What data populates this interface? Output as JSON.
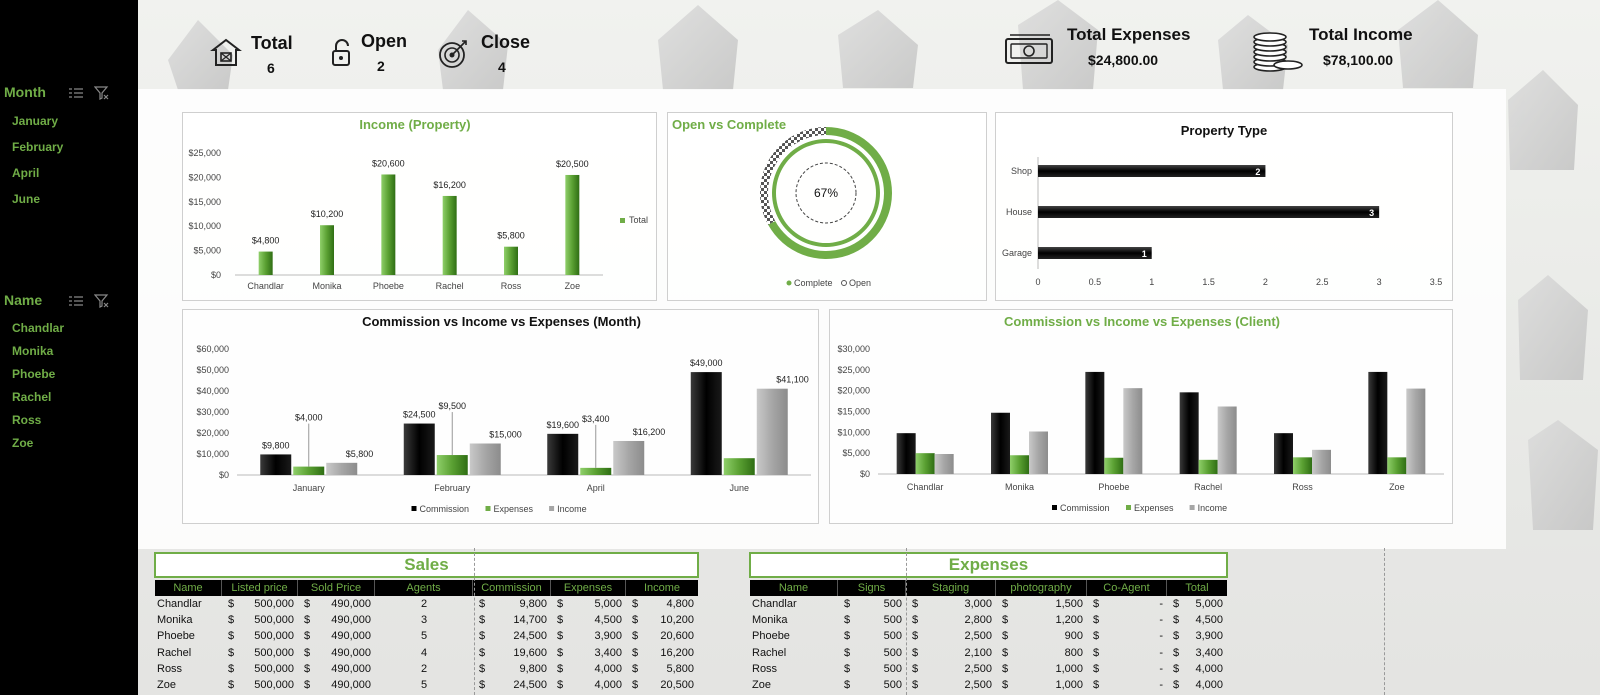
{
  "sidebar": {
    "month_slicer": {
      "title": "Month",
      "items": [
        "January",
        "February",
        "April",
        "June"
      ]
    },
    "name_slicer": {
      "title": "Name",
      "items": [
        "Chandlar",
        "Monika",
        "Phoebe",
        "Rachel",
        "Ross",
        "Zoe"
      ]
    }
  },
  "kpis": {
    "total": {
      "label": "Total",
      "value": "6"
    },
    "open": {
      "label": "Open",
      "value": "2"
    },
    "close": {
      "label": "Close",
      "value": "4"
    },
    "expenses": {
      "label": "Total Expenses",
      "value": "$24,800.00"
    },
    "income": {
      "label": "Total Income",
      "value": "$78,100.00"
    }
  },
  "colors": {
    "accent": "#70ad47",
    "dark": "#000000",
    "gray": "#a6a6a6"
  },
  "chart_data": [
    {
      "id": "income_property",
      "type": "bar",
      "title": "Income (Property)",
      "categories": [
        "Chandlar",
        "Monika",
        "Phoebe",
        "Rachel",
        "Ross",
        "Zoe"
      ],
      "series": [
        {
          "name": "Total",
          "values": [
            4800,
            10200,
            20600,
            16200,
            5800,
            20500
          ]
        }
      ],
      "data_labels": [
        "$4,800",
        "$10,200",
        "$20,600",
        "$16,200",
        "$5,800",
        "$20,500"
      ],
      "yticks": [
        "$0",
        "$5,000",
        "$10,000",
        "$15,000",
        "$20,000",
        "$25,000"
      ],
      "ylim": [
        0,
        25000
      ],
      "legend": "right"
    },
    {
      "id": "open_vs_complete",
      "type": "pie",
      "title": "Open vs Complete",
      "series": [
        {
          "name": "Complete",
          "value": 67
        },
        {
          "name": "Open",
          "value": 33
        }
      ],
      "center_label": "67%",
      "legend": "bottom",
      "legend_entries": [
        "Complete",
        "Open"
      ]
    },
    {
      "id": "property_type",
      "type": "bar",
      "orientation": "horizontal",
      "title": "Property Type",
      "categories": [
        "Shop",
        "House",
        "Garage"
      ],
      "values": [
        2,
        3,
        1
      ],
      "data_labels": [
        "2",
        "3",
        "1"
      ],
      "xticks": [
        "0",
        "0.5",
        "1",
        "1.5",
        "2",
        "2.5",
        "3",
        "3.5"
      ],
      "xlim": [
        0,
        3.5
      ]
    },
    {
      "id": "month_chart",
      "type": "bar",
      "title": "Commission vs Income vs Expenses (Month)",
      "categories": [
        "January",
        "February",
        "April",
        "June"
      ],
      "series": [
        {
          "name": "Commission",
          "values": [
            9800,
            24500,
            19600,
            49000
          ],
          "labels": [
            "$9,800",
            "$24,500",
            "$19,600",
            "$49,000"
          ]
        },
        {
          "name": "Expenses",
          "values": [
            4000,
            9500,
            3400,
            8000
          ],
          "labels": [
            "$4,000",
            "$9,500",
            "$3,400",
            ""
          ]
        },
        {
          "name": "Income",
          "values": [
            5800,
            15000,
            16200,
            41100
          ],
          "labels": [
            "$5,800",
            "$15,000",
            "$16,200",
            "$41,100"
          ]
        }
      ],
      "yticks": [
        "$0",
        "$10,000",
        "$20,000",
        "$30,000",
        "$40,000",
        "$50,000",
        "$60,000"
      ],
      "ylim": [
        0,
        60000
      ],
      "legend": "bottom"
    },
    {
      "id": "client_chart",
      "type": "bar",
      "title": "Commission vs Income vs Expenses (Client)",
      "categories": [
        "Chandlar",
        "Monika",
        "Phoebe",
        "Rachel",
        "Ross",
        "Zoe"
      ],
      "series": [
        {
          "name": "Commission",
          "values": [
            9800,
            14700,
            24500,
            19600,
            9800,
            24500
          ]
        },
        {
          "name": "Expenses",
          "values": [
            5000,
            4500,
            3900,
            3400,
            4000,
            4000
          ]
        },
        {
          "name": "Income",
          "values": [
            4800,
            10200,
            20600,
            16200,
            5800,
            20500
          ]
        }
      ],
      "yticks": [
        "$0",
        "$5,000",
        "$10,000",
        "$15,000",
        "$20,000",
        "$25,000",
        "$30,000"
      ],
      "ylim": [
        0,
        30000
      ],
      "legend": "bottom"
    }
  ],
  "sales_table": {
    "title": "Sales",
    "headers": [
      "Name",
      "Listed price",
      "Sold Price",
      "Agents",
      "Commission",
      "Expenses",
      "Income"
    ],
    "rows": [
      [
        "Chandlar",
        "500,000",
        "490,000",
        "2",
        "9,800",
        "5,000",
        "4,800"
      ],
      [
        "Monika",
        "500,000",
        "490,000",
        "3",
        "14,700",
        "4,500",
        "10,200"
      ],
      [
        "Phoebe",
        "500,000",
        "490,000",
        "5",
        "24,500",
        "3,900",
        "20,600"
      ],
      [
        "Rachel",
        "500,000",
        "490,000",
        "4",
        "19,600",
        "3,400",
        "16,200"
      ],
      [
        "Ross",
        "500,000",
        "490,000",
        "2",
        "9,800",
        "4,000",
        "5,800"
      ],
      [
        "Zoe",
        "500,000",
        "490,000",
        "5",
        "24,500",
        "4,000",
        "20,500"
      ]
    ]
  },
  "expenses_table": {
    "title": "Expenses",
    "headers": [
      "Name",
      "Signs",
      "Staging",
      "photography",
      "Co-Agent",
      "Total"
    ],
    "rows": [
      [
        "Chandlar",
        "500",
        "3,000",
        "1,500",
        "-",
        "5,000"
      ],
      [
        "Monika",
        "500",
        "2,800",
        "1,200",
        "-",
        "4,500"
      ],
      [
        "Phoebe",
        "500",
        "2,500",
        "900",
        "-",
        "3,900"
      ],
      [
        "Rachel",
        "500",
        "2,100",
        "800",
        "-",
        "3,400"
      ],
      [
        "Ross",
        "500",
        "2,500",
        "1,000",
        "-",
        "4,000"
      ],
      [
        "Zoe",
        "500",
        "2,500",
        "1,000",
        "-",
        "4,000"
      ]
    ]
  },
  "currency_symbol": "$"
}
